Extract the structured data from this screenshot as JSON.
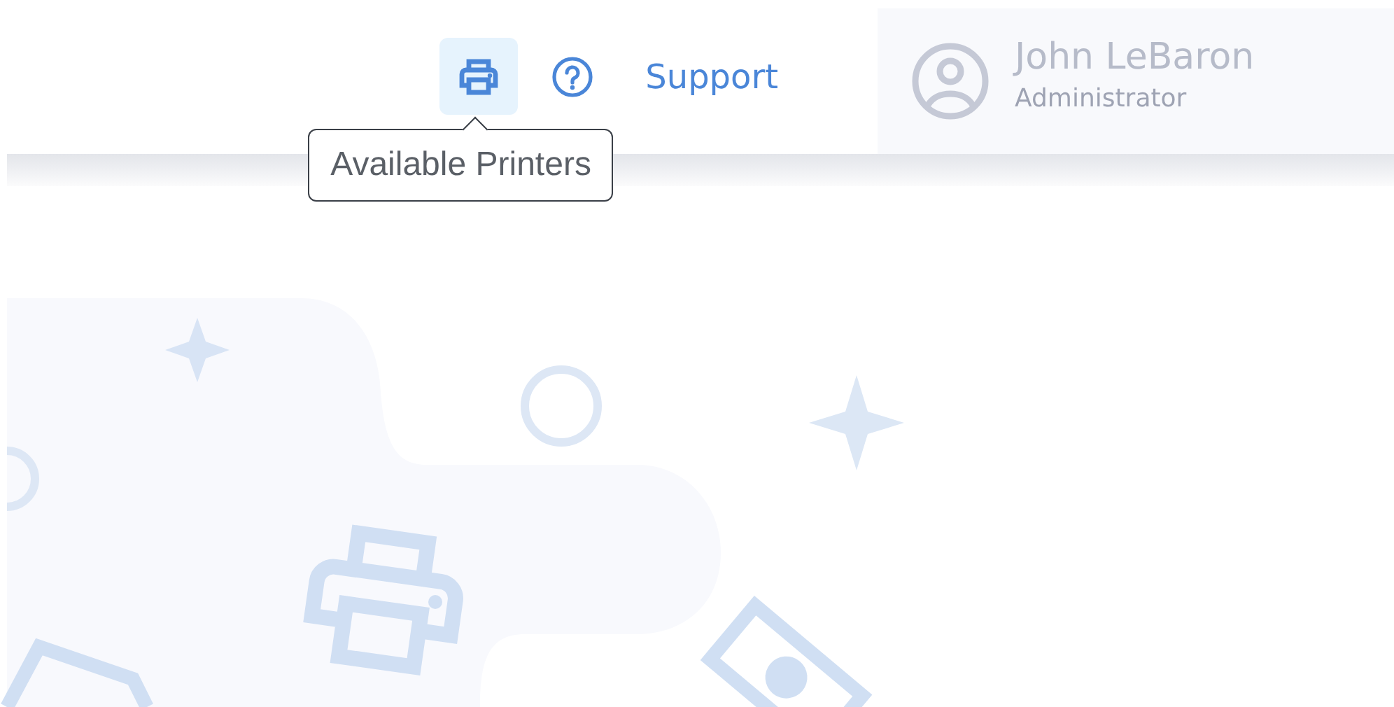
{
  "header": {
    "icon_buttons": [
      {
        "kind": "printer",
        "active": true,
        "tooltip": "Available Printers"
      },
      {
        "kind": "help",
        "active": false
      }
    ],
    "support_link": "Support",
    "user": {
      "name": "John LeBaron",
      "role": "Administrator"
    }
  }
}
